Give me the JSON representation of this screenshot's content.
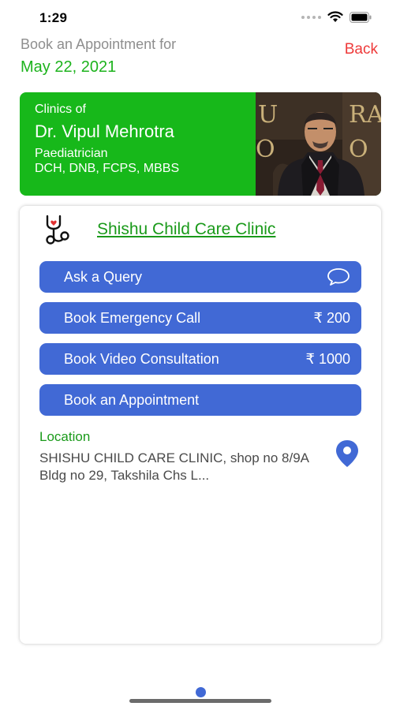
{
  "status_bar": {
    "time": "1:29"
  },
  "header": {
    "subtitle": "Book an Appointment for",
    "date": "May 22, 2021",
    "back_label": "Back"
  },
  "doctor": {
    "clinics_of": "Clinics of",
    "name": "Dr. Vipul Mehrotra",
    "specialty": "Paediatrician",
    "qualifications": "DCH, DNB, FCPS, MBBS"
  },
  "clinic": {
    "name": "Shishu Child Care Clinic",
    "actions": [
      {
        "label": "Ask a Query",
        "icon": "chat-bubble-icon"
      },
      {
        "label": "Book Emergency Call",
        "price": "₹ 200"
      },
      {
        "label": "Book Video Consultation",
        "price": "₹ 1000"
      },
      {
        "label": "Book an Appointment"
      }
    ],
    "location_label": "Location",
    "address": "SHISHU CHILD CARE CLINIC, shop no 8/9A Bldg no 29, Takshila Chs L..."
  },
  "colors": {
    "accent_green": "#17b81a",
    "button_blue": "#4169d5",
    "back_red": "#ee3a3a"
  }
}
